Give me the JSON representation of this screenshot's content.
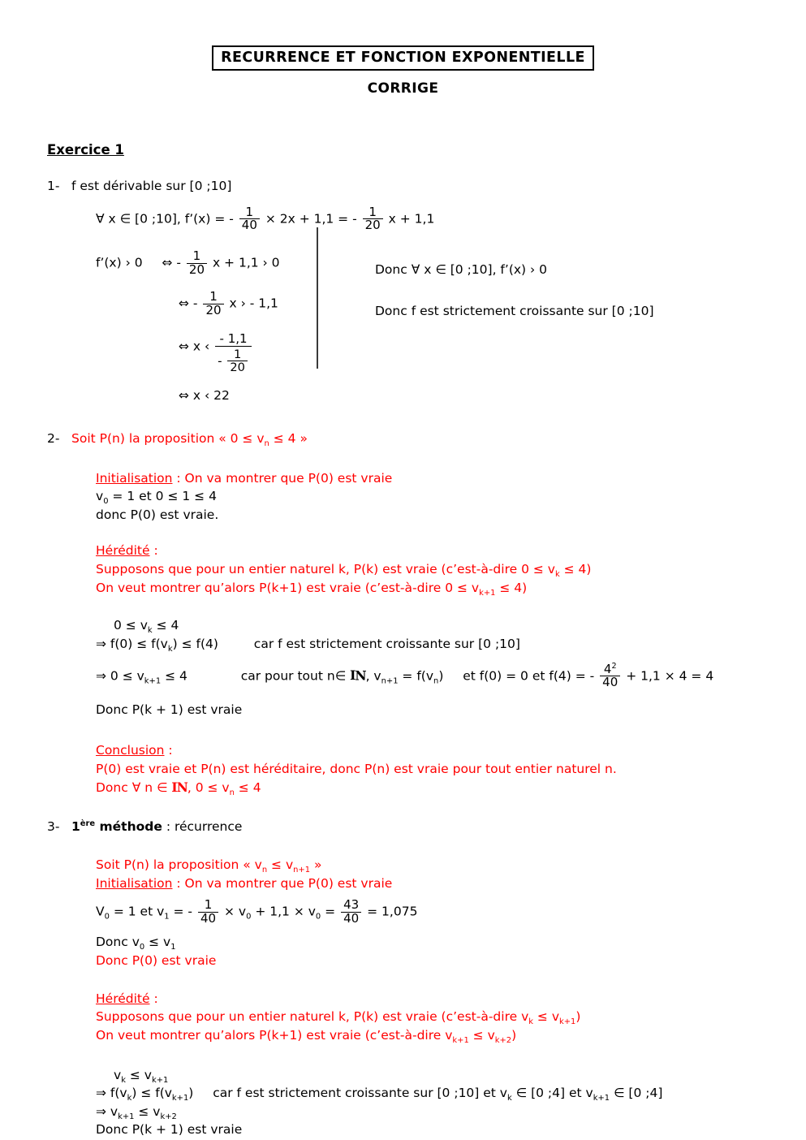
{
  "document": {
    "title": "RECURRENCE ET FONCTION EXPONENTIELLE",
    "subtitle": "CORRIGE",
    "exercise_heading": "Exercice 1",
    "colors": {
      "accent_red": "#FF0000",
      "text_black": "#000000"
    }
  },
  "q1": {
    "marker": "1-",
    "line1": "f est dérivable sur [0 ;10]",
    "line2_pre": "∀ x ∈ [0 ;10], f’(x) = -",
    "line2_frac1_num": "1",
    "line2_frac1_den": "40",
    "line2_mid": "× 2x + 1,1 = -",
    "line2_frac2_num": "1",
    "line2_frac2_den": "20",
    "line2_post": "x + 1,1",
    "ineq1_pre": "f’(x) › 0",
    "ineq1_sym": "⇔ -",
    "ineq1_num": "1",
    "ineq1_den": "20",
    "ineq1_post": "x + 1,1 › 0",
    "ineq2_sym": "⇔ -",
    "ineq2_num": "1",
    "ineq2_den": "20",
    "ineq2_post": "x › - 1,1",
    "ineq3_sym": "⇔ x ‹",
    "ineq3_num": "- 1,1",
    "ineq3_den_minus": "-",
    "ineq3_den_num": "1",
    "ineq3_den_den": "20",
    "ineq4": "⇔ x ‹ 22",
    "right1": "Donc ∀ x ∈ [0 ;10], f’(x) › 0",
    "right2": "Donc f est strictement croissante sur [0 ;10]"
  },
  "q2": {
    "marker": "2-",
    "proposition": "Soit P(n) la proposition « 0 ≤ v",
    "proposition_sub": "n",
    "proposition_end": " ≤ 4 »",
    "init_label": "Initialisation",
    "init_text": " : On va montrer que P(0) est vraie",
    "init_line1_pre": "v",
    "init_line1_sub": "0",
    "init_line1_post": " = 1 et 0 ≤ 1 ≤ 4",
    "init_line2": "donc P(0) est vraie.",
    "her_label": "Hérédité",
    "her_colon": " :",
    "her_line1_pre": "Supposons que pour un entier naturel k,  P(k) est vraie (c’est-à-dire 0 ≤ v",
    "her_line1_sub": "k",
    "her_line1_post": " ≤ 4)",
    "her_line2_pre": "On veut montrer qu’alors P(k+1) est vraie (c’est-à-dire 0 ≤ v",
    "her_line2_sub": "k+1",
    "her_line2_post": " ≤ 4)",
    "proof_l1_pre": "0 ≤ v",
    "proof_l1_sub": "k",
    "proof_l1_post": " ≤ 4",
    "proof_l2": "⇒ f(0) ≤ f(v",
    "proof_l2_sub": "k",
    "proof_l2_mid": ") ≤ f(4)",
    "proof_l2_tail": "car f est strictement croissante sur [0 ;10]",
    "proof_l3_pre": "⇒ 0 ≤ v",
    "proof_l3_sub": "k+1",
    "proof_l3_post": " ≤ 4",
    "proof_l3_car": "car pour tout n∈ ",
    "proof_l3_nat": "N",
    "proof_l3_rec_pre": ",  v",
    "proof_l3_rec_sub": "n+1",
    "proof_l3_rec_post": " = f(v",
    "proof_l3_rec_sub2": "n",
    "proof_l3_rec_end": ")",
    "proof_l3_f0": "et f(0) = 0  et   f(4) = -",
    "proof_l3_frac_num": "4",
    "proof_l3_frac_sup": "2",
    "proof_l3_frac_den": "40",
    "proof_l3_tail": "+ 1,1 × 4  = 4",
    "proof_l4": "Donc P(k + 1) est vraie",
    "conc_label": "Conclusion",
    "conc_colon": " :",
    "conc_line1": "P(0) est vraie et P(n) est héréditaire, donc P(n) est vraie pour tout entier naturel n.",
    "conc_line2_pre": "Donc ∀ n ∈ ",
    "conc_line2_nat": "N",
    "conc_line2_mid": ", 0 ≤ v",
    "conc_line2_sub": "n",
    "conc_line2_post": " ≤ 4"
  },
  "q3": {
    "marker": "3-",
    "method_num": "1",
    "method_sup": "ère",
    "method_word": " méthode",
    "method_tail": " : récurrence",
    "proposition_pre": "Soit P(n) la proposition « v",
    "proposition_sub": "n",
    "proposition_mid": " ≤ v",
    "proposition_sub2": "n+1",
    "proposition_end": " »",
    "init_label": "Initialisation",
    "init_text": " : On va montrer que P(0) est vraie",
    "calc_pre": "V",
    "calc_sub": "0",
    "calc_mid": " = 1 et v",
    "calc_sub2": "1",
    "calc_eq": " = -",
    "calc_frac1_num": "1",
    "calc_frac1_den": "40",
    "calc_after1": "× v",
    "calc_sub3": "0",
    "calc_after2": " + 1,1 × v",
    "calc_sub4": "0",
    "calc_after3": " =",
    "calc_frac2_num": "43",
    "calc_frac2_den": "40",
    "calc_result": "= 1,075",
    "donc_v_pre": "Donc v",
    "donc_v_sub": "0",
    "donc_v_mid": " ≤ v",
    "donc_v_sub2": "1",
    "donc_p0": "Donc P(0) est vraie",
    "her_label": "Hérédité",
    "her_colon": " :",
    "her_line1_pre": "Supposons que pour un entier naturel k,  P(k) est vraie (c’est-à-dire v",
    "her_line1_sub": "k",
    "her_line1_mid": " ≤ v",
    "her_line1_sub2": "k+1",
    "her_line1_post": ")",
    "her_line2_pre": "On veut montrer qu’alors P(k+1) est vraie (c’est-à-dire v",
    "her_line2_sub": "k+1",
    "her_line2_mid": " ≤ v",
    "her_line2_sub2": "k+2",
    "her_line2_post": ")",
    "proof_l1_pre": "v",
    "proof_l1_sub": "k",
    "proof_l1_mid": " ≤ v",
    "proof_l1_sub2": "k+1",
    "proof_l2_pre": "⇒ f(v",
    "proof_l2_sub": "k",
    "proof_l2_mid": ") ≤ f(v",
    "proof_l2_sub2": "k+1",
    "proof_l2_post": ")",
    "proof_l2_tail_pre": "car f est strictement croissante sur [0 ;10] et v",
    "proof_l2_tail_sub": "k",
    "proof_l2_tail_mid": " ∈ [0 ;4] et v",
    "proof_l2_tail_sub2": "k+1",
    "proof_l2_tail_post": " ∈ [0 ;4]",
    "proof_l3_pre": "⇒ v",
    "proof_l3_sub": "k+1",
    "proof_l3_mid": " ≤ v",
    "proof_l3_sub2": "k+2",
    "proof_l4": "Donc P(k + 1) est vraie"
  }
}
